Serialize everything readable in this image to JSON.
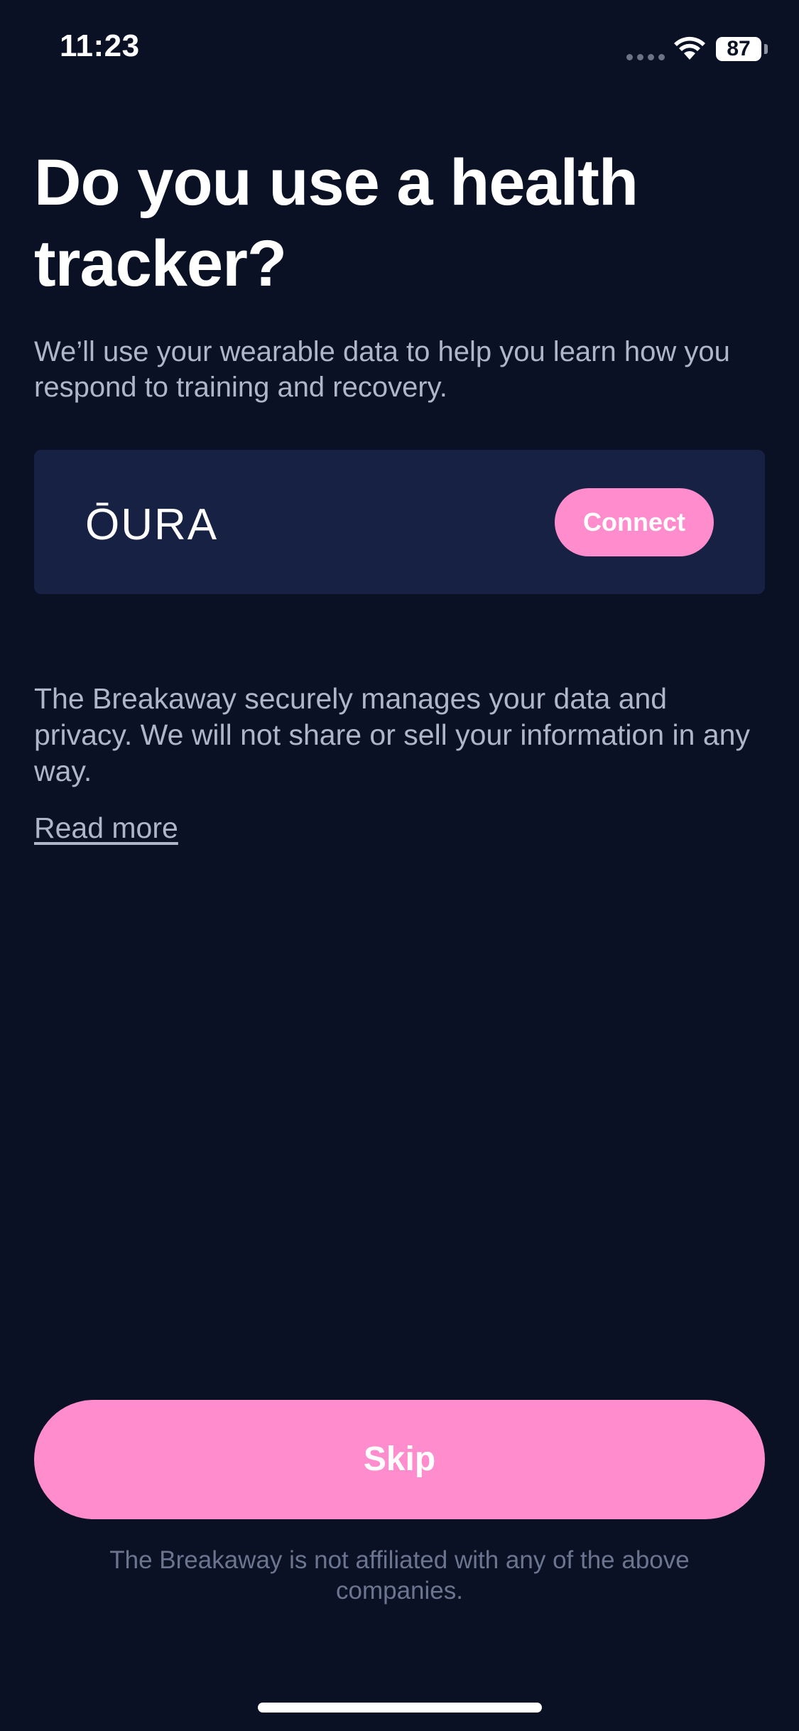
{
  "status_bar": {
    "time": "11:23",
    "battery": "87"
  },
  "heading": "Do you use a health tracker?",
  "intro": "We’ll use your wearable data to help you learn how you respond to training and recovery.",
  "trackers": [
    {
      "name": "ŌURA",
      "connect_label": "Connect"
    }
  ],
  "privacy": {
    "text": "The Breakaway securely manages your data and privacy. We will not share or sell your information in any way.",
    "read_more": "Read more"
  },
  "skip_label": "Skip",
  "disclaimer": "The Breakaway is not affiliated with any of the above companies.",
  "colors": {
    "background": "#0a1124",
    "card": "#172143",
    "accent": "#ff8ccd",
    "body_text": "#aeb6cb",
    "muted_text": "#6b7590"
  },
  "icons": [
    "cellular-signal-icon",
    "wifi-icon",
    "battery-icon"
  ]
}
